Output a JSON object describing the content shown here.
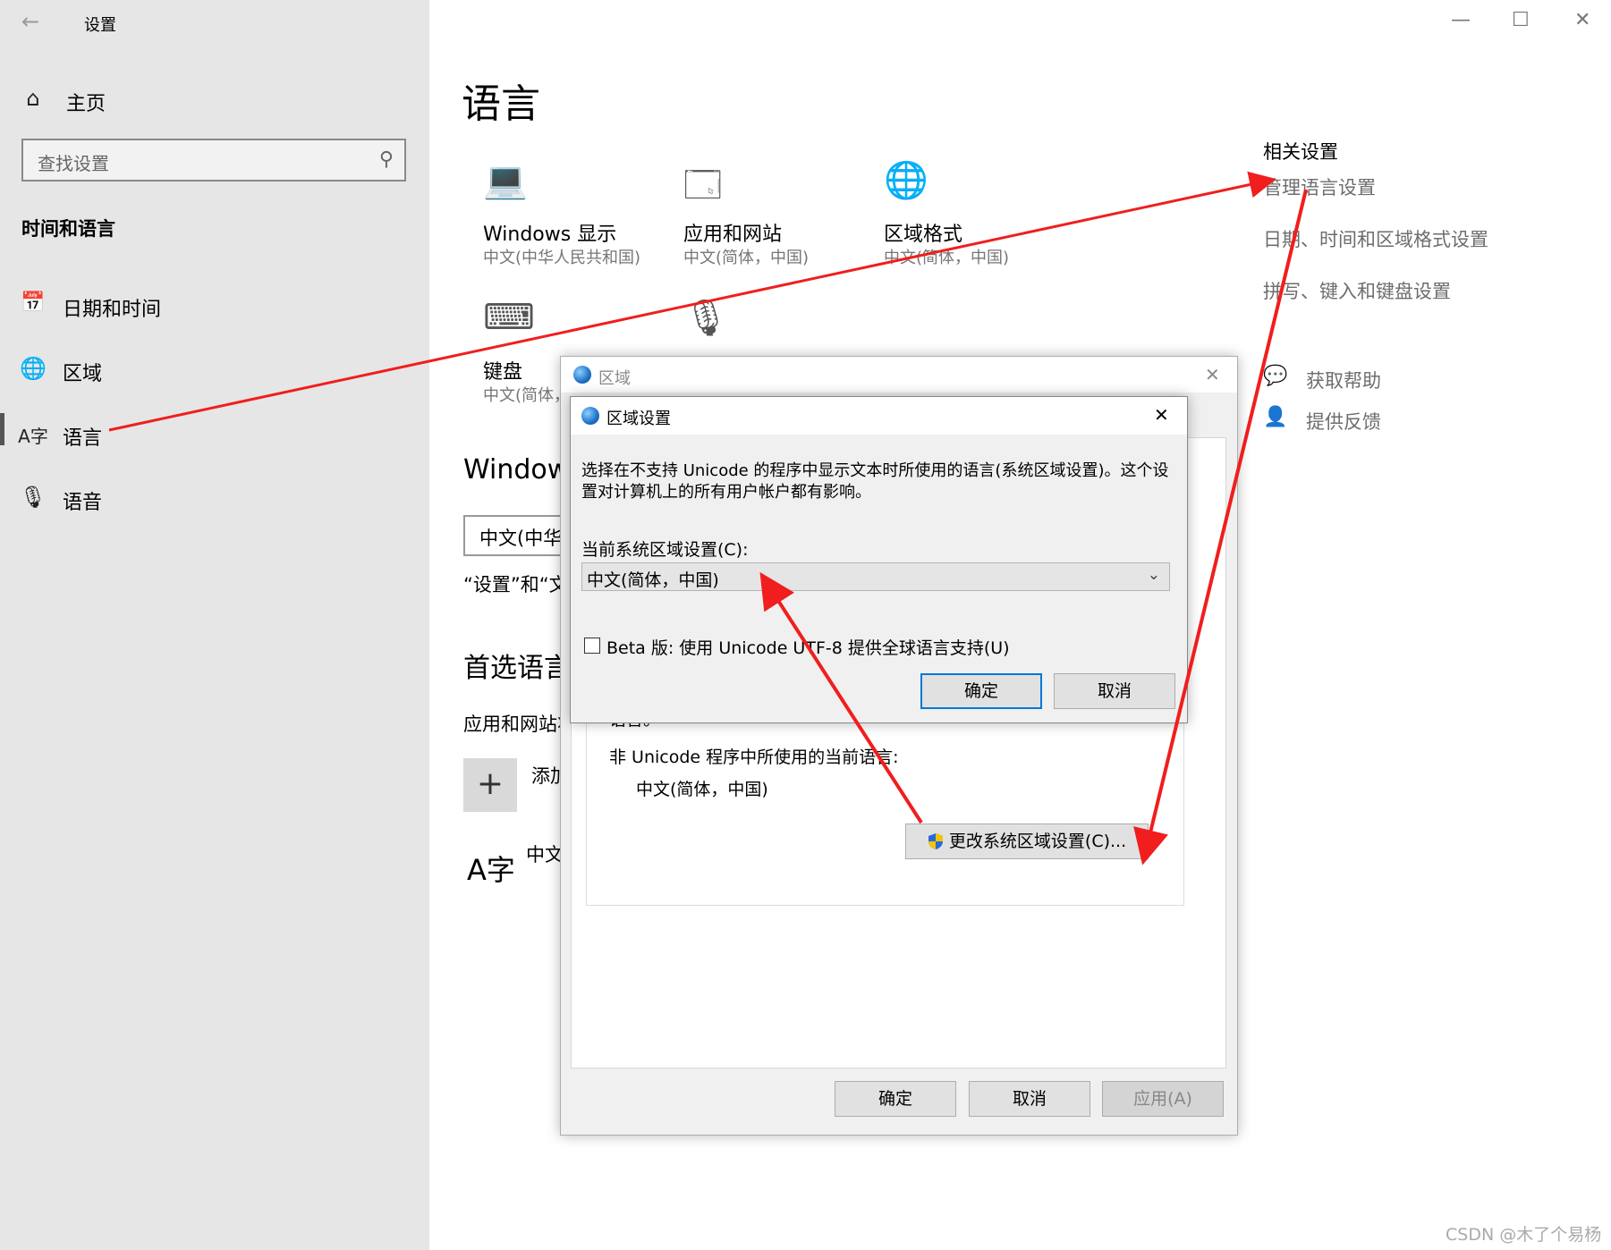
{
  "window": {
    "title": "设置",
    "controls": {
      "minimize": "—",
      "maximize": "☐",
      "close": "✕"
    }
  },
  "sidebar": {
    "back_icon": "arrow-left-icon",
    "home": {
      "icon": "home-icon",
      "label": "主页"
    },
    "search": {
      "placeholder": "查找设置",
      "icon": "search-icon"
    },
    "section_title": "时间和语言",
    "items": [
      {
        "icon": "calendar-clock-icon",
        "label": "日期和时间"
      },
      {
        "icon": "globe-grid-icon",
        "label": "区域"
      },
      {
        "icon": "language-icon",
        "label": "语言"
      },
      {
        "icon": "microphone-icon",
        "label": "语音"
      }
    ]
  },
  "main": {
    "page_title": "语言",
    "tiles": [
      {
        "icon": "laptop-icon",
        "label": "Windows 显示",
        "sub": "中文(中华人民共和国)"
      },
      {
        "icon": "window-icon",
        "label": "应用和网站",
        "sub": "中文(简体，中国)"
      },
      {
        "icon": "globe-format-icon",
        "label": "区域格式",
        "sub": "中文(简体，中国)"
      },
      {
        "icon": "keyboard-icon",
        "label": "键盘",
        "sub": "中文(简体，"
      },
      {
        "icon": "microphone-icon",
        "label": "",
        "sub": ""
      }
    ],
    "windows_heading": "Window",
    "display_lang_select": "中文(中华",
    "settings_note": "“设置”和“文",
    "preferred_heading": "首选语言",
    "apps_note": "应用和网站将",
    "add_label": "添加",
    "lang_item": "中文"
  },
  "related": {
    "title": "相关设置",
    "links": [
      "管理语言设置",
      "日期、时间和区域格式设置",
      "拼写、键入和键盘设置"
    ],
    "help": {
      "icon": "help-chat-icon",
      "label": "获取帮助"
    },
    "feedback": {
      "icon": "feedback-icon",
      "label": "提供反馈"
    }
  },
  "region_dialog": {
    "title": "区域",
    "close": "✕",
    "partial_text": "语言。",
    "current_lang_label": "非 Unicode 程序中所使用的当前语言:",
    "current_lang_value": "中文(简体，中国)",
    "change_btn": "更改系统区域设置(C)...",
    "ok": "确定",
    "cancel": "取消",
    "apply": "应用(A)"
  },
  "region_settings_dialog": {
    "title": "区域设置",
    "close": "✕",
    "description_line1": "选择在不支持 Unicode 的程序中显示文本时所使用的语言(系统区域设置)。这个设",
    "description_line2": "置对计算机上的所有用户帐户都有影响。",
    "current_locale_label": "当前系统区域设置(C):",
    "current_locale_value": "中文(简体，中国)",
    "beta_label": "Beta 版: 使用 Unicode UTF-8 提供全球语言支持(U)",
    "beta_checked": false,
    "ok": "确定",
    "cancel": "取消"
  },
  "watermark": "CSDN @木了个易杨",
  "colors": {
    "arrow": "#f01e1e",
    "sidebar_bg": "#e6e6e6",
    "primary_btn_border": "#0078d7"
  }
}
